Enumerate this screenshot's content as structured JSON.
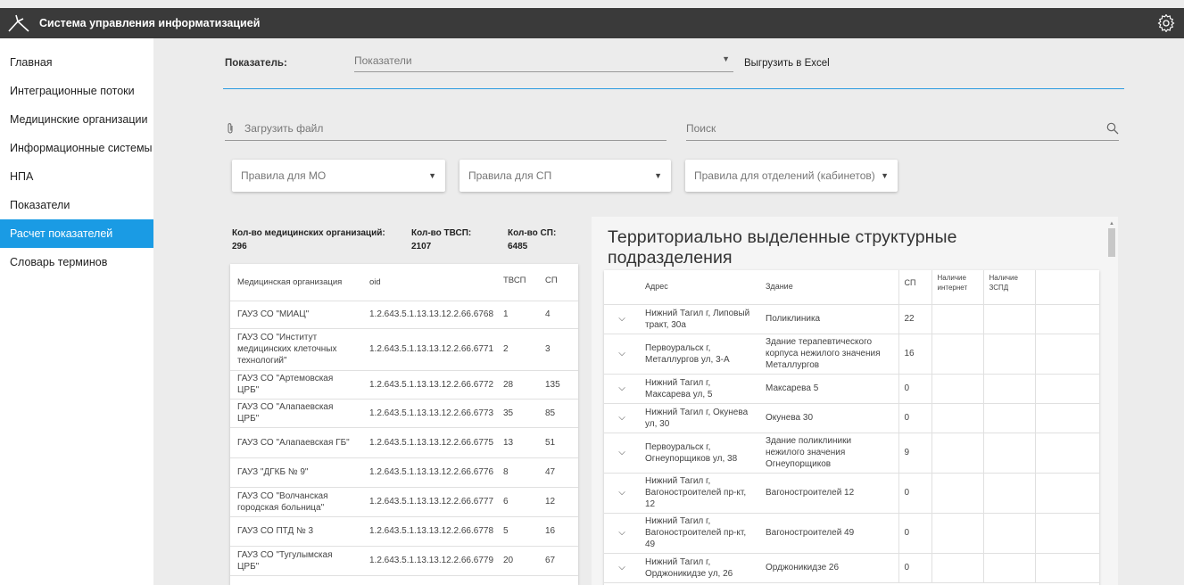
{
  "app": {
    "title": "Система управления информатизацией",
    "logo_icon": "branch-logo-icon",
    "settings_icon": "gear-icon"
  },
  "sidebar": {
    "items": [
      {
        "label": "Главная",
        "active": false
      },
      {
        "label": "Интеграционные потоки",
        "active": false
      },
      {
        "label": "Медицинские организации",
        "active": false
      },
      {
        "label": "Информационные системы",
        "active": false
      },
      {
        "label": "НПА",
        "active": false
      },
      {
        "label": "Показатели",
        "active": false
      },
      {
        "label": "Расчет показателей",
        "active": true
      },
      {
        "label": "Словарь терминов",
        "active": false
      }
    ],
    "active_color": "#1a9be4"
  },
  "filters": {
    "indicator_label": "Показатель:",
    "indicator_placeholder": "Показатели",
    "export_label": "Выгрузить в Excel",
    "upload_label": "Загрузить файл",
    "search_placeholder": "Поиск",
    "rules_mo": "Правила для МО",
    "rules_sp": "Правила для СП",
    "rules_dept": "Правила для отделений (кабинетов)"
  },
  "stats": {
    "mo_label": "Кол-во медицинских организаций:",
    "mo_value": "296",
    "tvsp_label": "Кол-во ТВСП:",
    "tvsp_value": "2107",
    "sp_label": "Кол-во СП:",
    "sp_value": "6485"
  },
  "org_table": {
    "columns": [
      "Медицинская организация",
      "oid",
      "ТВСП",
      "СП"
    ],
    "rows": [
      {
        "name": "ГАУЗ СО \"МИАЦ\"",
        "oid": "1.2.643.5.1.13.13.12.2.66.6768",
        "tvsp": "1",
        "sp": "4"
      },
      {
        "name": "ГАУЗ СО \"Институт медицинских клеточных технологий\"",
        "oid": "1.2.643.5.1.13.13.12.2.66.6771",
        "tvsp": "2",
        "sp": "3"
      },
      {
        "name": "ГАУЗ СО \"Артемовская ЦРБ\"",
        "oid": "1.2.643.5.1.13.13.12.2.66.6772",
        "tvsp": "28",
        "sp": "135"
      },
      {
        "name": "ГАУЗ СО \"Алапаевская ЦРБ\"",
        "oid": "1.2.643.5.1.13.13.12.2.66.6773",
        "tvsp": "35",
        "sp": "85"
      },
      {
        "name": "ГАУЗ СО \"Алапаевская ГБ\"",
        "oid": "1.2.643.5.1.13.13.12.2.66.6775",
        "tvsp": "13",
        "sp": "51"
      },
      {
        "name": "ГАУЗ \"ДГКБ № 9\"",
        "oid": "1.2.643.5.1.13.13.12.2.66.6776",
        "tvsp": "8",
        "sp": "47"
      },
      {
        "name": "ГАУЗ СО \"Волчанская городская больница\"",
        "oid": "1.2.643.5.1.13.13.12.2.66.6777",
        "tvsp": "6",
        "sp": "12"
      },
      {
        "name": "ГАУЗ СО ПТД № 3",
        "oid": "1.2.643.5.1.13.13.12.2.66.6778",
        "tvsp": "5",
        "sp": "16"
      },
      {
        "name": "ГАУЗ СО \"Тугулымская ЦРБ\"",
        "oid": "1.2.643.5.1.13.13.12.2.66.6779",
        "tvsp": "20",
        "sp": "67"
      }
    ]
  },
  "tvsp_panel": {
    "title": "Территориально выделенные структурные подразделения",
    "columns": [
      "",
      "Адрес",
      "Здание",
      "СП",
      "Наличие интернет",
      "Наличие ЗСПД"
    ],
    "rows": [
      {
        "address": "Нижний Тагил г, Липовый тракт, 30а",
        "building": "Поликлиника",
        "sp": "22"
      },
      {
        "address": "Первоуральск г, Металлургов ул, 3-А",
        "building": "Здание терапевтического корпуса нежилого значения Металлургов",
        "sp": "16"
      },
      {
        "address": "Нижний Тагил г, Максарева ул, 5",
        "building": "Максарева 5",
        "sp": "0"
      },
      {
        "address": "Нижний Тагил г, Окунева ул, 30",
        "building": "Окунева 30",
        "sp": "0"
      },
      {
        "address": "Первоуральск г, Огнеупорщиков ул, 38",
        "building": "Здание поликлиники нежилого значения Огнеупорщиков",
        "sp": "9"
      },
      {
        "address": "Нижний Тагил г, Вагоностроителей пр-кт, 12",
        "building": "Вагоностроителей 12",
        "sp": "0"
      },
      {
        "address": "Нижний Тагил г, Вагоностроителей пр-кт, 49",
        "building": "Вагоностроителей 49",
        "sp": "0"
      },
      {
        "address": "Нижний Тагил г, Орджоникидзе ул, 26",
        "building": "Орджоникидзе 26",
        "sp": "0"
      }
    ]
  }
}
